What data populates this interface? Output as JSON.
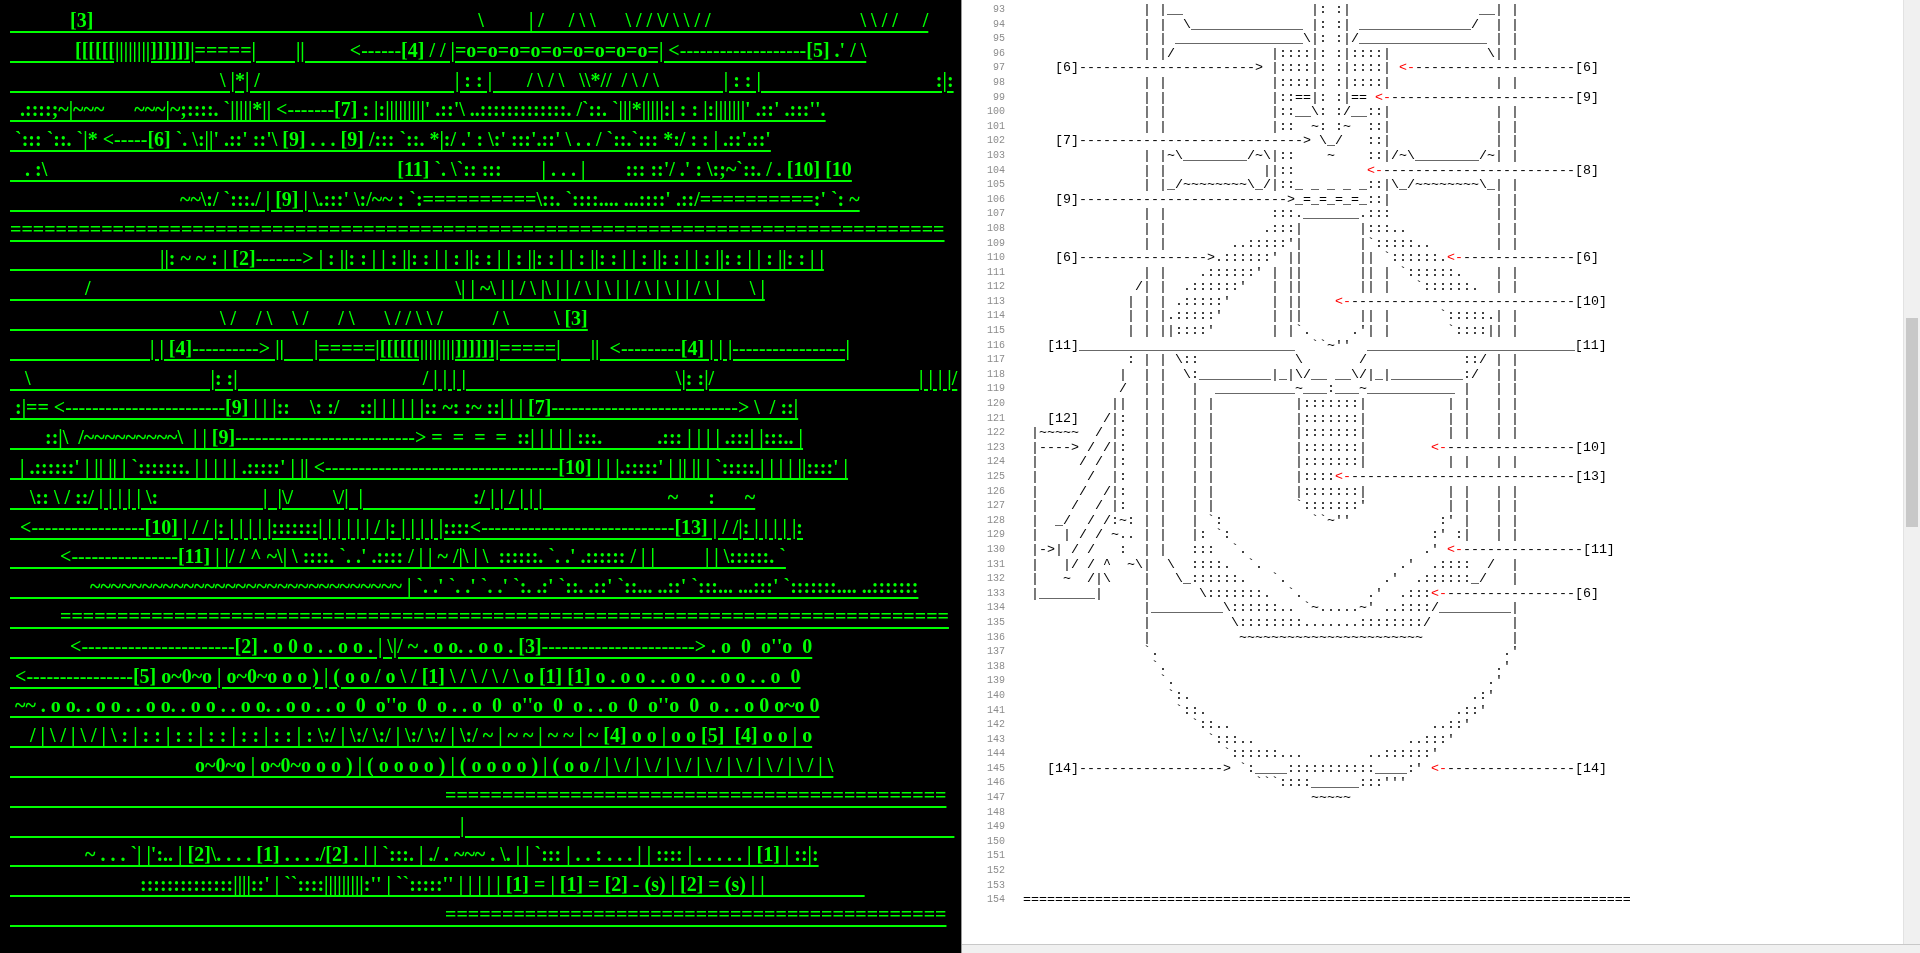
{
  "left_panel": {
    "lines": [
      "            [3]                                                                             \\         | /     / \\ \\      \\ / / \\/ \\ \\ / /                              \\ \\ / /     /",
      "             [[[[[[||||||||]]]]]]|=====|        ||         <------[4] / / |=o=o=o=o=o=o=o=o=o=| <-------------------[5] .' / \\",
      "                                          \\ |*| /                                       | : : |       / \\ / \\   \\\\*//  / \\ / \\             | : : |                                   :|:",
      "  .::::;~|~~~      ~~~|~;::::. `|||||*|| <-------[7] : |:|||||||||' .::'\\ ..:::::::::::::. /`::. `|||*|||||:| : : |:|||||||' .::' .:::''.",
      " `::: `::. `|* <-----[6] `. \\:||' .::' ::'\\ [9] . . . [9] /::: `::. *|:/ .' : \\:' :::'.::' \\ . . / `::.`::: *:/ : : | .::'.::'",
      "   . :\\                                                                      [11] `. \\`:: :::        | . . . |        ::: ::'/ .' : \\:;~`::. / . [10] [10",
      "                                  ~~\\:/ `:::./ | [9] | \\.:::' \\:/~~ : `:==========\\::. `::::.... ...::::' .::/==========:' `: ~",
      "==================================================================================",
      "                              ||: ~ ~ : | [2]-------> | : ||: : | | : ||: : | | : ||: : | | : ||: : | | : ||: : | | : ||: : | | : ||: : | | : ||: : | |",
      "               /                                                                         \\| | ~\\ | | / \\ |\\ | | / \\ | \\ | | / \\ | \\ | | / \\ |      \\ |",
      "                                          \\ /    / \\    \\ /      / \\      \\ / / \\ \\ /          / \\         \\ [3]",
      "                            | | [4]----------> ||      |=====|[[[[[[||||||||]]]]]]|=====|      ||  <---------[4] | | |-----------------|",
      "   \\                                    |: :|                                     / | | | |                                          \\|: :|/                                         | | | |/",
      " :|== <------------------------[9] | | |::    \\: :/    ::| | | | | |:: ~: :~ ::| | | [7]----------------------------> \\  / ::|",
      "       ::|\\  /~~~~~~~~~\\  | | [9]---------------------------> =  =  =  =  ::| | | | | :::.           .::: | | | | .:::| |:::.. |",
      "  | .::::::' | || || | `:::::::. | | | | | .:::::' | || <-----------------------------------[10] | | |.:::::' | || || | `:::::.| | | | ||::::' |",
      "    \\:: \\ / ::/ | | | | | \\:                     |  |\\/        \\/|  |                      :/ | | / | | |                         ~      :      ~",
      "  <-----------------[10] | / / |: | | | | |:::::::| | | | | | / |: | | | | |::::<-----------------------------[13] | / /|: | | | | |:",
      "          <----------------[11] | |/ / ^ ~\\| \\ ::::. `. .' .:::: / | | ~ /|\\ | \\  ::::::. `. .' .:::::: / | |          | | \\::::::. `",
      "                ~~~~~~~~~~~~~~~~~~~~~~~~~~~~~~ | `. .' `. .' `. .' `:. .:' `::. .::' `::... ..::' `:::... ...:::' `:::::::.... ..:::::::",
      "          ==============================================================================",
      "            <-----------------------[2] . o 0 o . . o o . | \\|/ ~ . o o. . o o . [3]-----------------------> . o  0  o''o  0",
      " <----------------[5] o~0~o | o~0~o o o ) | ( o o / o \\ / [1] \\ / \\ / \\ / \\ o [1] [1] o . o o . . o o . . o o . . o  0",
      " ~~ . o o. . o o . . o o. . o o . . o o. . o o . . o  0  o''o  0  o . . o  0  o''o  0  o . . o  0  o''o  0  o . . o 0 o~o 0",
      "    / | \\ / | \\ / | \\ : | : : | : : | : : | : : | : : | : \\:/ | \\:/ \\:/ | \\:/ \\:/ | \\:/ ~ | ~ ~ | ~ ~ | ~ [4] o o | o o [5]  [4] o o | o",
      "                                     o~0~o | o~0~o o o ) | ( o o o o ) | ( o o o o ) | ( o o / | \\ / | \\ / | \\ / | \\ / | \\ / | \\ / | \\ / | \\",
      "                                                                                       ============================================",
      "                                                                                          |                                                                                                  ",
      "               ~ . . . `| |':.. | [2]\\. . . . [1] . . . ./[2] . | | `:::. | ./ . ~~~ . \\. | | `::: | . . : . . . | | :::: | . . . . . | [1] | ::|:",
      "                          ::::::::::::::||||::' | ``::::|||||||||:'' | ``:::::'' | | | | | [1] = | [1] = [2] - (s) | [2] = (s) | |                    ",
      "                                                                                       ============================================"
    ]
  },
  "editor": {
    "lines": [
      {
        "number": "93",
        "segments": [
          {
            "kind": "text",
            "text": "               | |__                |: :|                __| |"
          }
        ]
      },
      {
        "number": "94",
        "segments": [
          {
            "kind": "text",
            "text": "               | |  \\______________ |: :| ______________/  | |"
          }
        ]
      },
      {
        "number": "95",
        "segments": [
          {
            "kind": "text",
            "text": "               | | ________________\\|: :|/________________ | |"
          }
        ]
      },
      {
        "number": "96",
        "segments": [
          {
            "kind": "text",
            "text": "               | |/            |::::|: :|::::|            \\| |"
          }
        ]
      },
      {
        "number": "97",
        "segments": [
          {
            "kind": "text",
            "text": "    [6]----------------------> |::::|: :|::::| "
          },
          {
            "kind": "arrow",
            "text": "<-"
          },
          {
            "kind": "text",
            "text": "--------------------[6]"
          }
        ]
      },
      {
        "number": "98",
        "segments": [
          {
            "kind": "text",
            "text": "               | |             |::::|: :|::::|             | |"
          }
        ]
      },
      {
        "number": "99",
        "segments": [
          {
            "kind": "text",
            "text": "               | |             |::==|: :|== "
          },
          {
            "kind": "arrow",
            "text": "<-"
          },
          {
            "kind": "text",
            "text": "-----------------------[9]"
          }
        ]
      },
      {
        "number": "100",
        "segments": [
          {
            "kind": "text",
            "text": "               | |             |::__\\: :/__::|             | |"
          }
        ]
      },
      {
        "number": "101",
        "segments": [
          {
            "kind": "text",
            "text": "               | |             |::  ~: :~  ::|             | |"
          }
        ]
      },
      {
        "number": "102",
        "segments": [
          {
            "kind": "text",
            "text": "    [7]----------------------------> \\_/   ::|             | |"
          }
        ]
      },
      {
        "number": "103",
        "segments": [
          {
            "kind": "text",
            "text": "               | |~\\________/~\\|::    ~    ::|/~\\________/~| |"
          }
        ]
      },
      {
        "number": "104",
        "segments": [
          {
            "kind": "text",
            "text": "               | |            ||::         "
          },
          {
            "kind": "arrow",
            "text": "<-"
          },
          {
            "kind": "text",
            "text": "------------------------[8]"
          }
        ]
      },
      {
        "number": "105",
        "segments": [
          {
            "kind": "text",
            "text": "               | |_/~~~~~~~~\\_/|::_ _ _ _ _::|\\_/~~~~~~~~\\_| |"
          }
        ]
      },
      {
        "number": "106",
        "segments": [
          {
            "kind": "text",
            "text": "    [9]-------------------------->_=_=_=_=_::|             | |"
          }
        ]
      },
      {
        "number": "107",
        "segments": [
          {
            "kind": "text",
            "text": "               | |             :::._______.:::             | |"
          }
        ]
      },
      {
        "number": "108",
        "segments": [
          {
            "kind": "text",
            "text": "               | |            .:::|       |:::..           | |"
          }
        ]
      },
      {
        "number": "109",
        "segments": [
          {
            "kind": "text",
            "text": "               | |        ..:::::'|       |`:::::..        | |"
          }
        ]
      },
      {
        "number": "110",
        "segments": [
          {
            "kind": "text",
            "text": "    [6]---------------->.::::::' ||       || `::::::."
          },
          {
            "kind": "arrow",
            "text": "<-"
          },
          {
            "kind": "text",
            "text": "--------------[6]"
          }
        ]
      },
      {
        "number": "111",
        "segments": [
          {
            "kind": "text",
            "text": "               | |    .::::::' | ||       || | `::::::.    | |"
          }
        ]
      },
      {
        "number": "112",
        "segments": [
          {
            "kind": "text",
            "text": "              /| |  .::::::'   | ||       || |   `::::::.  | |"
          }
        ]
      },
      {
        "number": "113",
        "segments": [
          {
            "kind": "text",
            "text": "             | | | .:::::'     | ||    "
          },
          {
            "kind": "arrow",
            "text": "<-"
          },
          {
            "kind": "text",
            "text": "----------------------------[10]"
          }
        ]
      },
      {
        "number": "114",
        "segments": [
          {
            "kind": "text",
            "text": "             | | |.:::::'      | ||       || |      `:::::.| |"
          }
        ]
      },
      {
        "number": "115",
        "segments": [
          {
            "kind": "text",
            "text": "             | | ||::::'       | |`.     .'| |       `::::|| |"
          }
        ]
      },
      {
        "number": "116",
        "segments": [
          {
            "kind": "text",
            "text": "   [11]___________________________  ``~''  __________________________[11]"
          }
        ]
      },
      {
        "number": "117",
        "segments": [
          {
            "kind": "text",
            "text": "             : | | \\::            \\       /            ::/ | |"
          }
        ]
      },
      {
        "number": "118",
        "segments": [
          {
            "kind": "text",
            "text": "            |  | |  \\:_________|_|\\/__ __\\/|_|_________:/  | |"
          }
        ]
      },
      {
        "number": "119",
        "segments": [
          {
            "kind": "text",
            "text": "            /  | |   |  __________~___:___~___________ |   | |"
          }
        ]
      },
      {
        "number": "120",
        "segments": [
          {
            "kind": "text",
            "text": "           ||  | |   | |          |:::::::|          | |   | |"
          }
        ]
      },
      {
        "number": "121",
        "segments": [
          {
            "kind": "text",
            "text": "   [12]   /|:  | |   | |          |:::::::|          | |   | |"
          }
        ]
      },
      {
        "number": "122",
        "segments": [
          {
            "kind": "text",
            "text": " |~~~~~  / |:  | |   | |          |:::::::|          | |   | |"
          }
        ]
      },
      {
        "number": "123",
        "segments": [
          {
            "kind": "text",
            "text": " |----> / /|:  | |   | |          |:::::::|        "
          },
          {
            "kind": "arrow",
            "text": "<-"
          },
          {
            "kind": "text",
            "text": "----------------[10]"
          }
        ]
      },
      {
        "number": "124",
        "segments": [
          {
            "kind": "text",
            "text": " |     / / |:  | |   | |          |:::::::|          | |   | |"
          }
        ]
      },
      {
        "number": "125",
        "segments": [
          {
            "kind": "text",
            "text": " |      /  |:  | |   | |          |::::"
          },
          {
            "kind": "arrow",
            "text": "<-"
          },
          {
            "kind": "text",
            "text": "----------------------------[13]"
          }
        ]
      },
      {
        "number": "126",
        "segments": [
          {
            "kind": "text",
            "text": " |     /  /|:  | |   | |          |:::::::|          | |   | |"
          }
        ]
      },
      {
        "number": "127",
        "segments": [
          {
            "kind": "text",
            "text": " |    /  / |:  | |   | |          `:::::::'          | |   | |"
          }
        ]
      },
      {
        "number": "128",
        "segments": [
          {
            "kind": "text",
            "text": " |  _/  / /:~: | |   | `:           ``~''           :' |   | |"
          }
        ]
      },
      {
        "number": "129",
        "segments": [
          {
            "kind": "text",
            "text": " |   | / / ~.. | |   |: `:                         :' :|   | |"
          }
        ]
      },
      {
        "number": "130",
        "segments": [
          {
            "kind": "text",
            "text": " |->| / /   :  | |   :::  `.                      .' "
          },
          {
            "kind": "arrow",
            "text": "<-"
          },
          {
            "kind": "text",
            "text": "---------------[11]"
          }
        ]
      },
      {
        "number": "131",
        "segments": [
          {
            "kind": "text",
            "text": " |   |/ / ^  ~\\|  \\  ::::.  `.                 .'  .::::  /  |"
          }
        ]
      },
      {
        "number": "132",
        "segments": [
          {
            "kind": "text",
            "text": " |   ~  /|\\    |   \\_::::::.   `.            .'  .::::::_/   |"
          }
        ]
      },
      {
        "number": "133",
        "segments": [
          {
            "kind": "text",
            "text": " |_______|     |      \\:::::::.  `.        .'  .:::"
          },
          {
            "kind": "arrow",
            "text": "<-"
          },
          {
            "kind": "text",
            "text": "----------------[6]"
          }
        ]
      },
      {
        "number": "134",
        "segments": [
          {
            "kind": "text",
            "text": "               |_________\\::::::.. `~.....~' ..::::/_________|"
          }
        ]
      },
      {
        "number": "135",
        "segments": [
          {
            "kind": "text",
            "text": "               |          \\::::::::.......::::::::/          |"
          }
        ]
      },
      {
        "number": "136",
        "segments": [
          {
            "kind": "text",
            "text": "               |           ~~~~~~~~~~~~~~~~~~~~~~~           |"
          }
        ]
      },
      {
        "number": "137",
        "segments": [
          {
            "kind": "text",
            "text": "               `.                                           .'"
          }
        ]
      },
      {
        "number": "138",
        "segments": [
          {
            "kind": "text",
            "text": "                `.                                         .'"
          }
        ]
      },
      {
        "number": "139",
        "segments": [
          {
            "kind": "text",
            "text": "                 `.                                       .'"
          }
        ]
      },
      {
        "number": "140",
        "segments": [
          {
            "kind": "text",
            "text": "                  `:.                                   .:'"
          }
        ]
      },
      {
        "number": "141",
        "segments": [
          {
            "kind": "text",
            "text": "                   `::.                               .::'"
          }
        ]
      },
      {
        "number": "142",
        "segments": [
          {
            "kind": "text",
            "text": "                     `::..                         ..::'"
          }
        ]
      },
      {
        "number": "143",
        "segments": [
          {
            "kind": "text",
            "text": "                       `:::..                   ..:::'"
          }
        ]
      },
      {
        "number": "144",
        "segments": [
          {
            "kind": "text",
            "text": "                         `::::::...        ..::::::'"
          }
        ]
      },
      {
        "number": "145",
        "segments": [
          {
            "kind": "text",
            "text": "   [14]------------------> `:____:::::::::::____:' "
          },
          {
            "kind": "arrow",
            "text": "<-"
          },
          {
            "kind": "text",
            "text": "----------------[14]"
          }
        ]
      },
      {
        "number": "146",
        "segments": [
          {
            "kind": "text",
            "text": "                             ```::::______:::'''"
          }
        ]
      },
      {
        "number": "147",
        "segments": [
          {
            "kind": "text",
            "text": "                                    ~~~~~"
          }
        ]
      },
      {
        "number": "148"
      },
      {
        "number": "149"
      },
      {
        "number": "150"
      },
      {
        "number": "151"
      },
      {
        "number": "152"
      },
      {
        "number": "153"
      },
      {
        "number": "154",
        "segments": [
          {
            "kind": "text",
            "text": "============================================================================"
          }
        ]
      }
    ]
  }
}
